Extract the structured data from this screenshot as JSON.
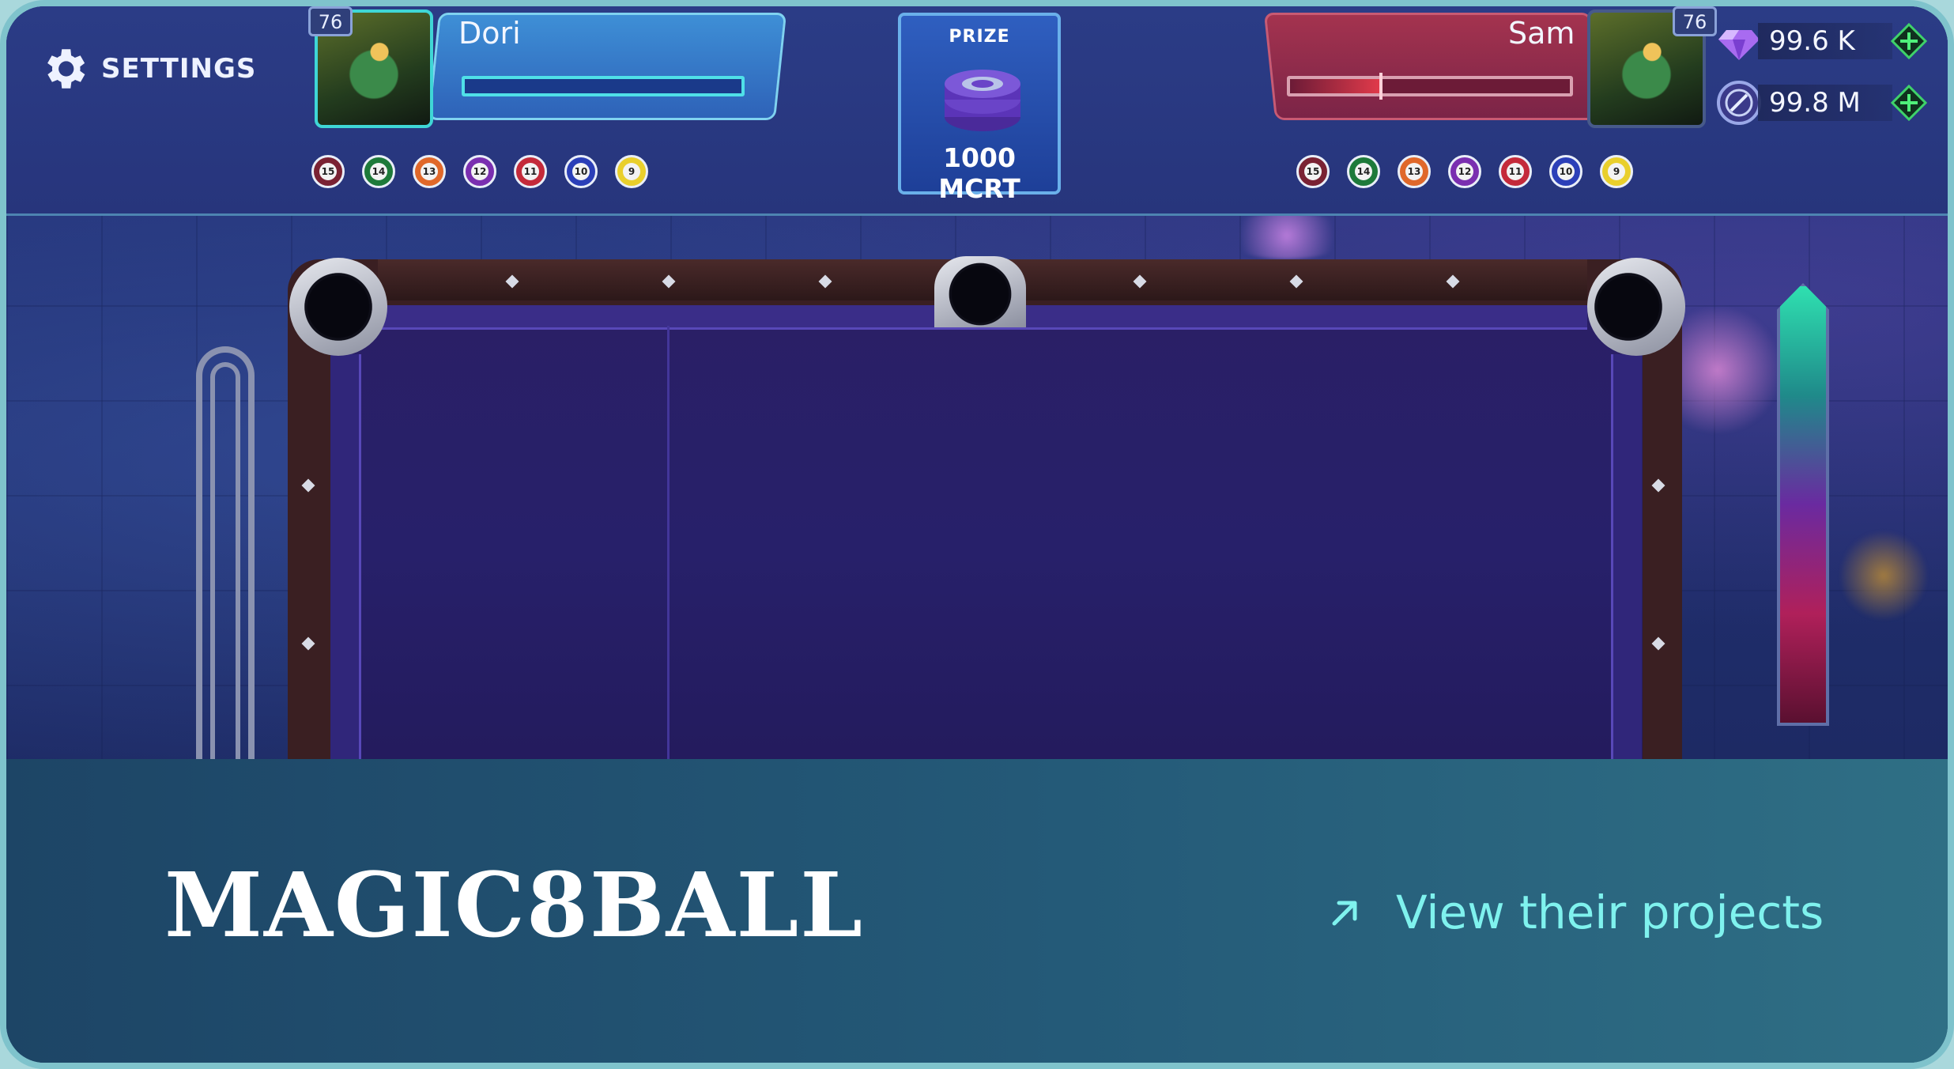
{
  "hud": {
    "settings_label": "SETTINGS",
    "player_left": {
      "name": "Dori",
      "level": "76"
    },
    "player_right": {
      "name": "Sam",
      "level": "76",
      "shot_timer_fraction": 0.32
    },
    "prize": {
      "label": "PRIZE",
      "value": "1000 MCRT"
    },
    "currency": {
      "gems": "99.6 K",
      "coins": "99.8 M"
    },
    "balls_left": [
      "15",
      "14",
      "13",
      "12",
      "11",
      "10",
      "9"
    ],
    "balls_right": [
      "15",
      "14",
      "13",
      "12",
      "11",
      "10",
      "9"
    ],
    "ball_colors": [
      "#7a2233",
      "#1e7a3a",
      "#e0682a",
      "#7a2fb0",
      "#c42a3a",
      "#2b3fb8",
      "#e9cf2c"
    ]
  },
  "card": {
    "studio_name": "MAGIC8BALL",
    "link_label": "View their projects"
  },
  "colors": {
    "accent_cyan": "#7ff2ee",
    "band_dark": "#1d4566",
    "felt": "#27206a"
  }
}
